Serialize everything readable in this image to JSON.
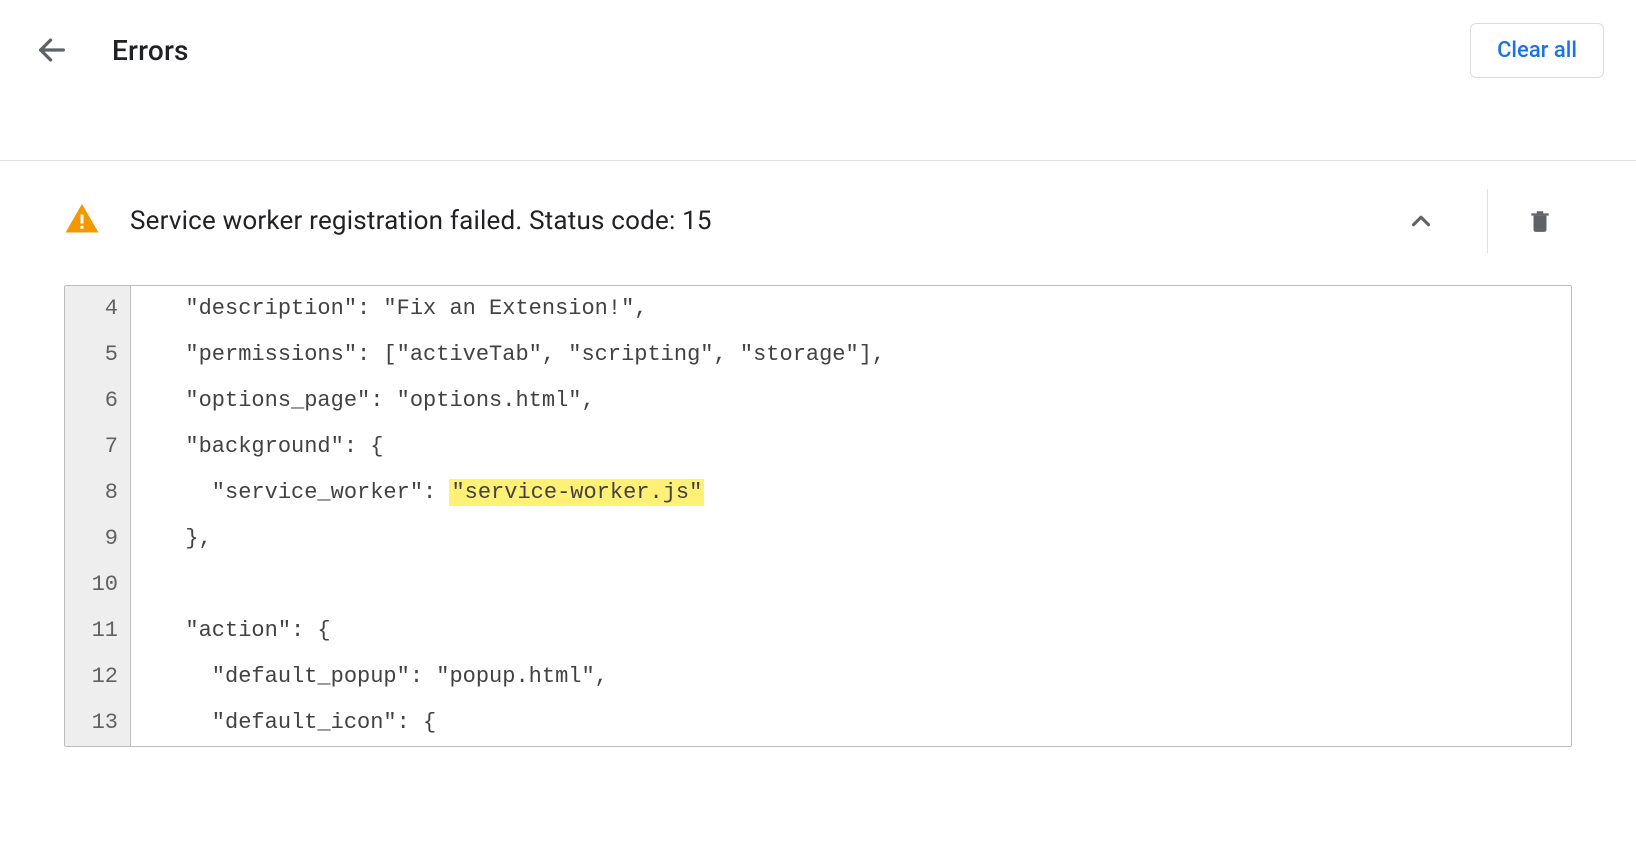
{
  "header": {
    "title": "Errors",
    "clear_all_label": "Clear all"
  },
  "error": {
    "message": "Service worker registration failed. Status code: 15"
  },
  "code": {
    "lines": [
      {
        "n": "4",
        "pre": "  \"description\": \"Fix an Extension!\",",
        "hl": "",
        "post": ""
      },
      {
        "n": "5",
        "pre": "  \"permissions\": [\"activeTab\", \"scripting\", \"storage\"],",
        "hl": "",
        "post": ""
      },
      {
        "n": "6",
        "pre": "  \"options_page\": \"options.html\",",
        "hl": "",
        "post": ""
      },
      {
        "n": "7",
        "pre": "  \"background\": {",
        "hl": "",
        "post": ""
      },
      {
        "n": "8",
        "pre": "    \"service_worker\": ",
        "hl": "\"service-worker.js\"",
        "post": ""
      },
      {
        "n": "9",
        "pre": "  },",
        "hl": "",
        "post": ""
      },
      {
        "n": "10",
        "pre": "",
        "hl": "",
        "post": ""
      },
      {
        "n": "11",
        "pre": "  \"action\": {",
        "hl": "",
        "post": ""
      },
      {
        "n": "12",
        "pre": "    \"default_popup\": \"popup.html\",",
        "hl": "",
        "post": ""
      },
      {
        "n": "13",
        "pre": "    \"default_icon\": {",
        "hl": "",
        "post": ""
      }
    ]
  }
}
